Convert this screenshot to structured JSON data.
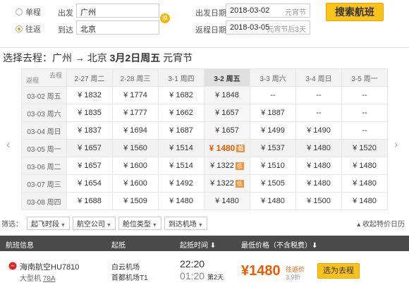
{
  "trip": {
    "oneway_label": "单程",
    "roundtrip_label": "往返",
    "from_label": "出发",
    "to_label": "到达",
    "from_value": "广州",
    "to_value": "北京",
    "swap_label": "换",
    "depart_label": "出发日期",
    "depart_value": "2018-03-02",
    "depart_hint": "元宵节",
    "return_label": "返程日期",
    "return_value": "2018-03-05",
    "return_hint": "元宵节后3天",
    "search_button": "搜索航班"
  },
  "heading": {
    "prefix": "选择去程：广州 → 北京",
    "date": "3月2日周五",
    "holiday": "元宵节"
  },
  "grid": {
    "corner_top": "去程",
    "corner_bottom": "返程",
    "columns": [
      "2-27 周二",
      "2-28 周三",
      "3-1 周四",
      "3-2 周五",
      "3-3 周六",
      "3-4 周日",
      "3-5 周一"
    ],
    "rows": [
      {
        "label": "03-02 周五",
        "cells": [
          "¥ 1832",
          "¥ 1774",
          "¥ 1682",
          "¥ 1848",
          "--",
          "--",
          "--"
        ]
      },
      {
        "label": "03-03 周六",
        "cells": [
          "¥ 1835",
          "¥ 1777",
          "¥ 1662",
          "¥ 1657",
          "¥ 1887",
          "--",
          "--"
        ]
      },
      {
        "label": "03-04 周日",
        "cells": [
          "¥ 1837",
          "¥ 1694",
          "¥ 1687",
          "¥ 1657",
          "¥ 1499",
          "¥ 1490",
          "--"
        ]
      },
      {
        "label": "03-05 周一",
        "cells": [
          "¥ 1657",
          "¥ 1560",
          "¥ 1514",
          "¥ 1480",
          "¥ 1537",
          "¥ 1480",
          "¥ 1520"
        ]
      },
      {
        "label": "03-06 周二",
        "cells": [
          "¥ 1657",
          "¥ 1600",
          "¥ 1514",
          "¥ 1322",
          "¥ 1510",
          "¥ 1480",
          "¥ 1480"
        ]
      },
      {
        "label": "03-07 周三",
        "cells": [
          "¥ 1654",
          "¥ 1600",
          "¥ 1492",
          "¥ 1322",
          "¥ 1505",
          "¥ 1480",
          "¥ 1480"
        ]
      },
      {
        "label": "03-08 周四",
        "cells": [
          "¥ 1688",
          "¥ 1509",
          "¥ 1480",
          "¥ 1480",
          "¥ 1480",
          "¥ 1500",
          "¥ 1480"
        ]
      }
    ],
    "low_tag": "低",
    "selected_col": 3,
    "selected_row": 3,
    "low_cells": [
      [
        3,
        3
      ],
      [
        4,
        3
      ],
      [
        5,
        3
      ]
    ]
  },
  "filters": {
    "label": "筛选：",
    "items": [
      "起飞时段",
      "航空公司",
      "舱位类型",
      "到达机场"
    ],
    "collapse": "收起特价日历"
  },
  "list_header": {
    "info": "航班信息",
    "depart": "起抵",
    "time": "起抵时间 ⬇",
    "price": "最低价格（不含税费）⬇"
  },
  "flight": {
    "airline": "海南航空HU7810",
    "plane": "大型机",
    "plane_code": "78A",
    "from_airport": "白云机场",
    "to_airport": "首都机场T1",
    "depart_time": "22:20",
    "arrive_time": "01:20",
    "arrive_day": "第2天",
    "price": "¥1480",
    "price_note": "往返价",
    "discount": "3.9折",
    "choose_label": "选为去程"
  },
  "colors": {
    "accent": "#fbc21c",
    "price": "#f15a00",
    "header_dark": "#4a4a4a"
  }
}
